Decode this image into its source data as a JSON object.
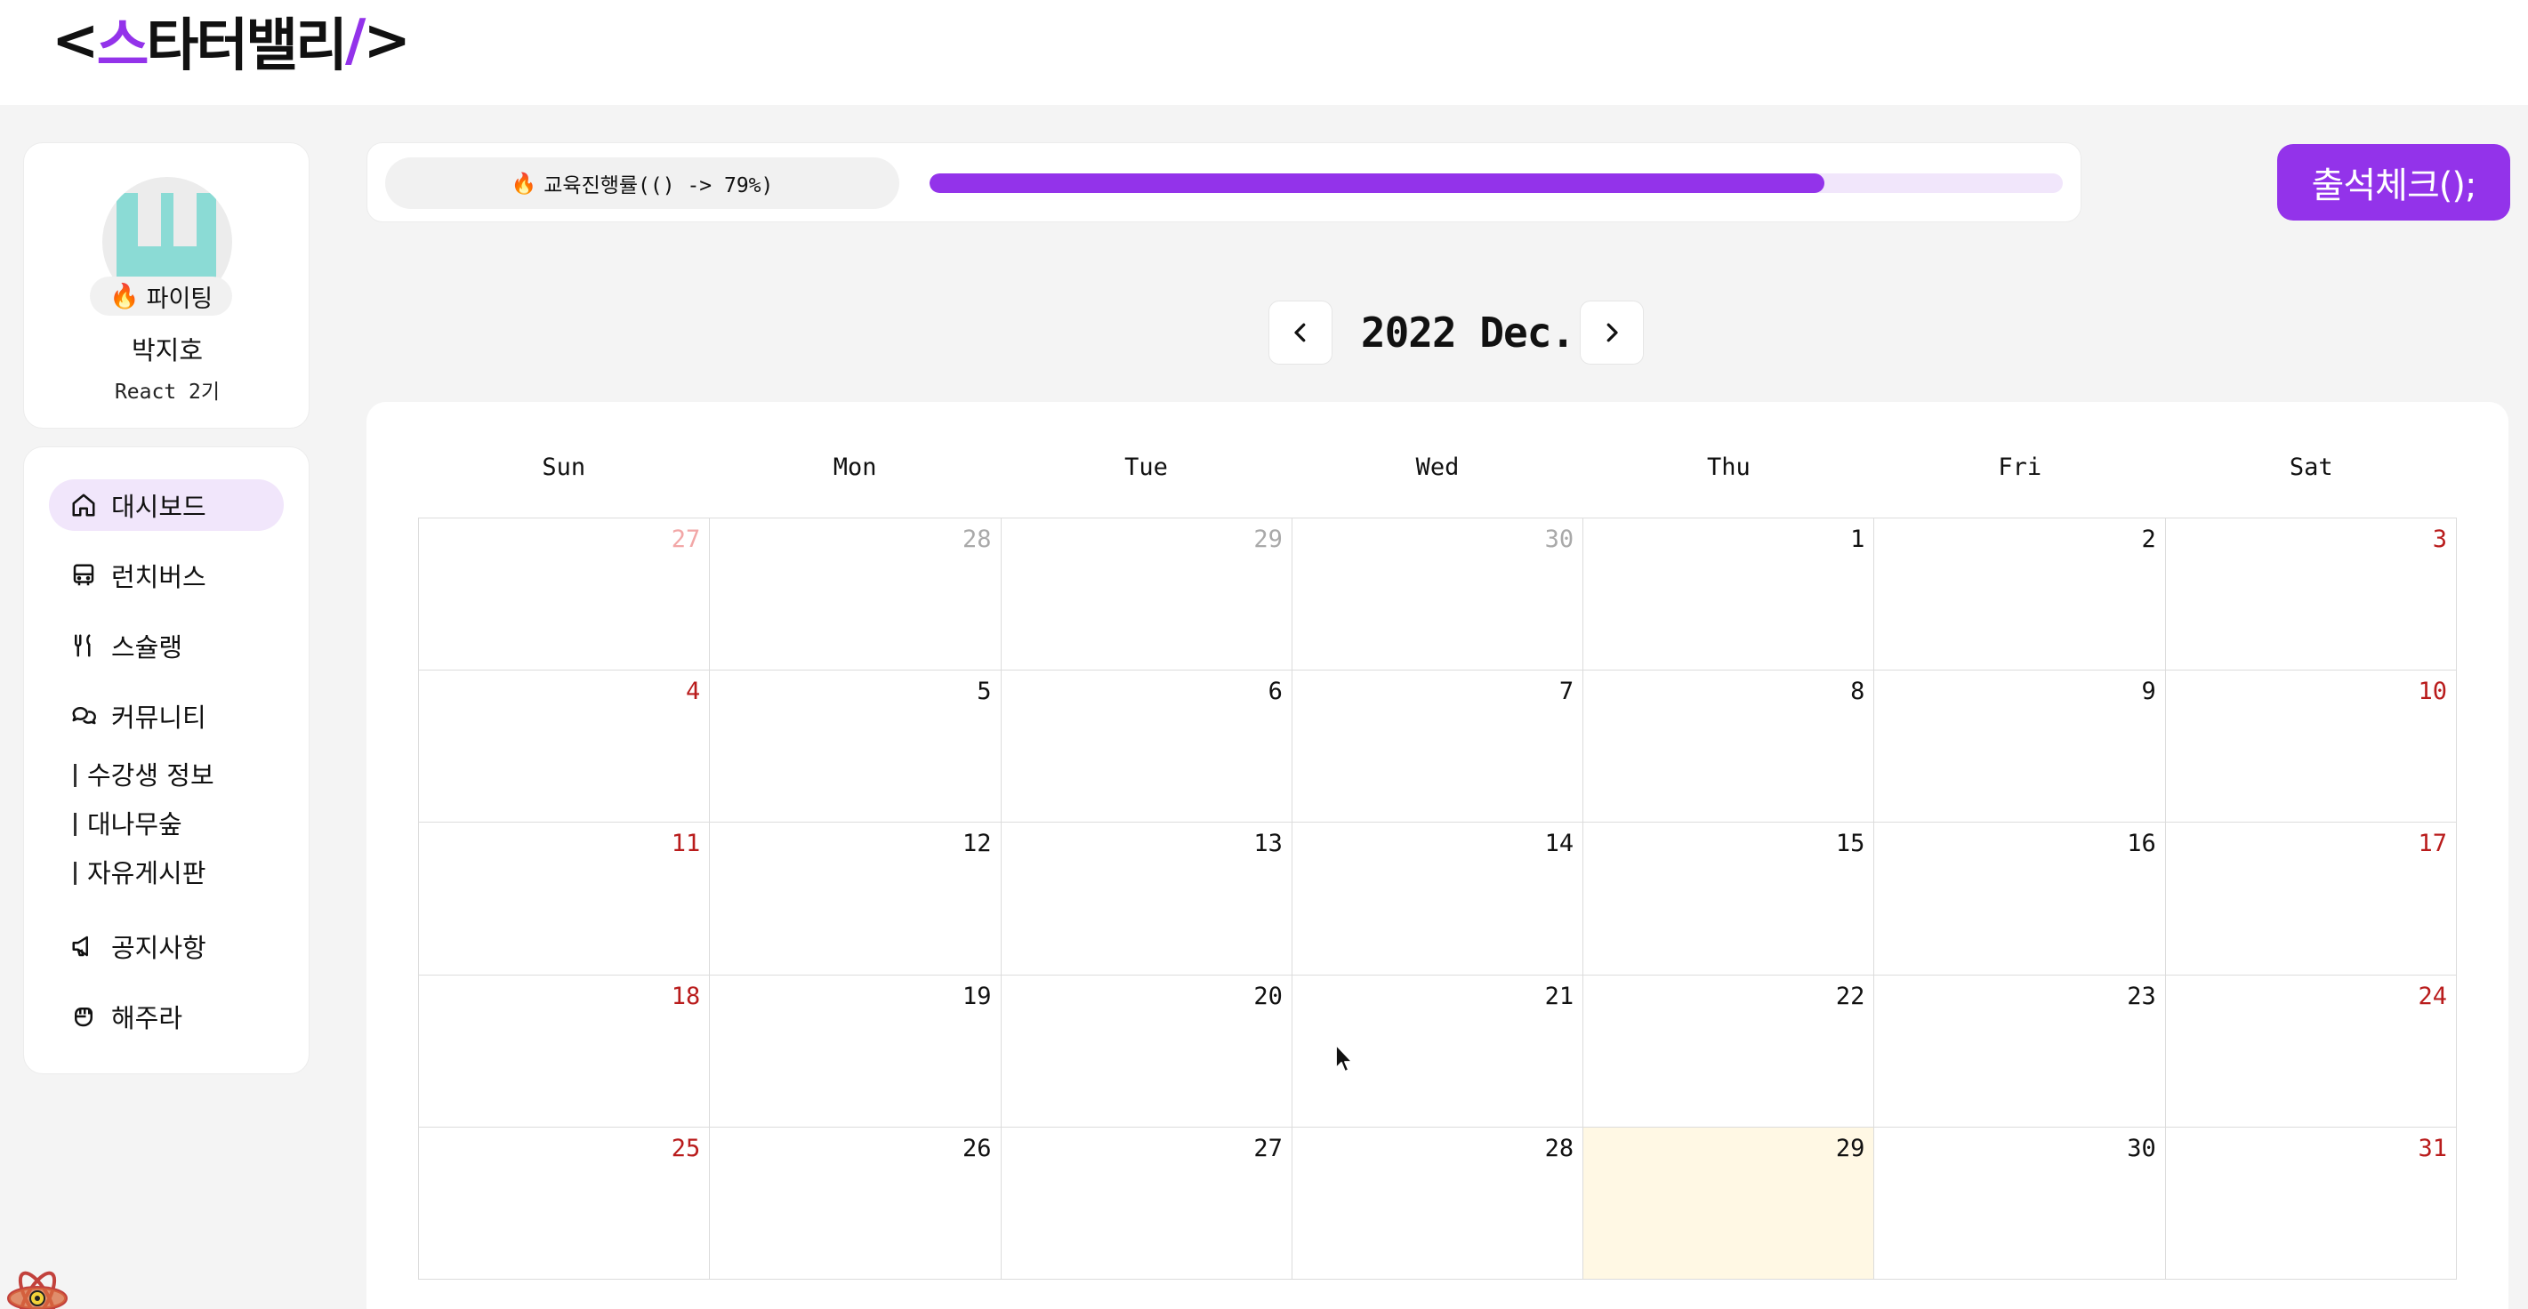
{
  "header": {
    "logo": {
      "left_bracket": "<",
      "accent_first": "스",
      "rest": "타터밸리",
      "slash": "/",
      "right_bracket": ">"
    }
  },
  "profile": {
    "badge_emoji": "🔥",
    "badge_text": "파이팅",
    "name": "박지호",
    "class": "React 2기"
  },
  "sidebar": {
    "items": [
      {
        "label": "대시보드",
        "icon": "home-icon",
        "active": true
      },
      {
        "label": "런치버스",
        "icon": "bus-icon",
        "active": false
      },
      {
        "label": "스슐랭",
        "icon": "utensils-icon",
        "active": false
      },
      {
        "label": "커뮤니티",
        "icon": "chat-bubbles-icon",
        "active": false
      },
      {
        "label": "공지사항",
        "icon": "megaphone-icon",
        "active": false
      },
      {
        "label": "해주라",
        "icon": "fist-icon",
        "active": false
      }
    ],
    "community_subitems": [
      "수강생 정보",
      "대나무숲",
      "자유게시판"
    ]
  },
  "progress": {
    "emoji": "🔥",
    "label": "교육진행률(() -> 79%)",
    "value": 0.79
  },
  "attendance_button": "출석체크();",
  "calendar": {
    "title": "2022 Dec.",
    "weekdays": [
      "Sun",
      "Mon",
      "Tue",
      "Wed",
      "Thu",
      "Fri",
      "Sat"
    ],
    "weeks": [
      [
        "27",
        "28",
        "29",
        "30",
        "1",
        "2",
        "3"
      ],
      [
        "4",
        "5",
        "6",
        "7",
        "8",
        "9",
        "10"
      ],
      [
        "11",
        "12",
        "13",
        "14",
        "15",
        "16",
        "17"
      ],
      [
        "18",
        "19",
        "20",
        "21",
        "22",
        "23",
        "24"
      ],
      [
        "25",
        "26",
        "27",
        "28",
        "29",
        "30",
        "31"
      ]
    ],
    "outside_month_first_week_count": 4,
    "today": "29"
  },
  "colors": {
    "accent": "#9333ea",
    "accent_light": "#f1e6fb",
    "weekend": "#b91c1c",
    "today_bg": "#fff8e4"
  }
}
